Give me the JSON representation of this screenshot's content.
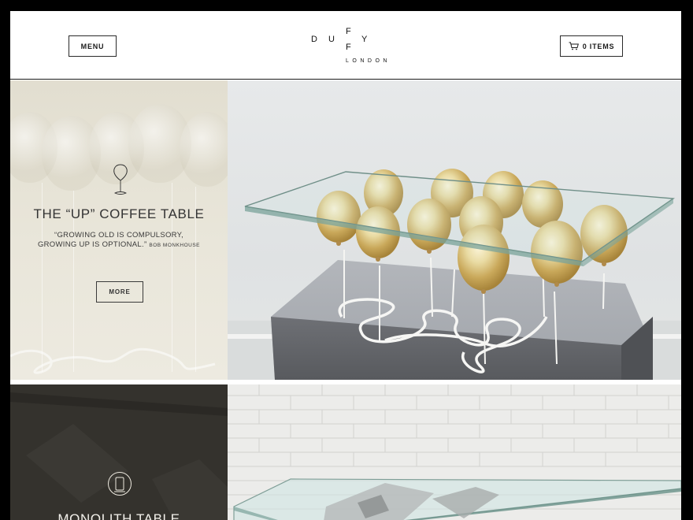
{
  "header": {
    "menu_label": "MENU",
    "cart_label": "0 ITEMS",
    "logo": {
      "letters": [
        "D",
        "U",
        "F",
        "F",
        "Y"
      ],
      "subtitle": "LONDON"
    }
  },
  "features": [
    {
      "title": "THE “UP” COFFEE TABLE",
      "quote": "“GROWING OLD IS COMPULSORY, GROWING UP IS OPTIONAL.”",
      "quote_author": "BOB MONKHOUSE",
      "button_label": "MORE",
      "icon": "balloon-icon"
    },
    {
      "title": "MONOLITH TABLE",
      "icon": "monolith-icon"
    }
  ],
  "colors": {
    "panel_light": "#e6e3d6",
    "panel_dark": "#34322d",
    "gold": "#c9a85a",
    "outline": "#2a2a2a"
  }
}
